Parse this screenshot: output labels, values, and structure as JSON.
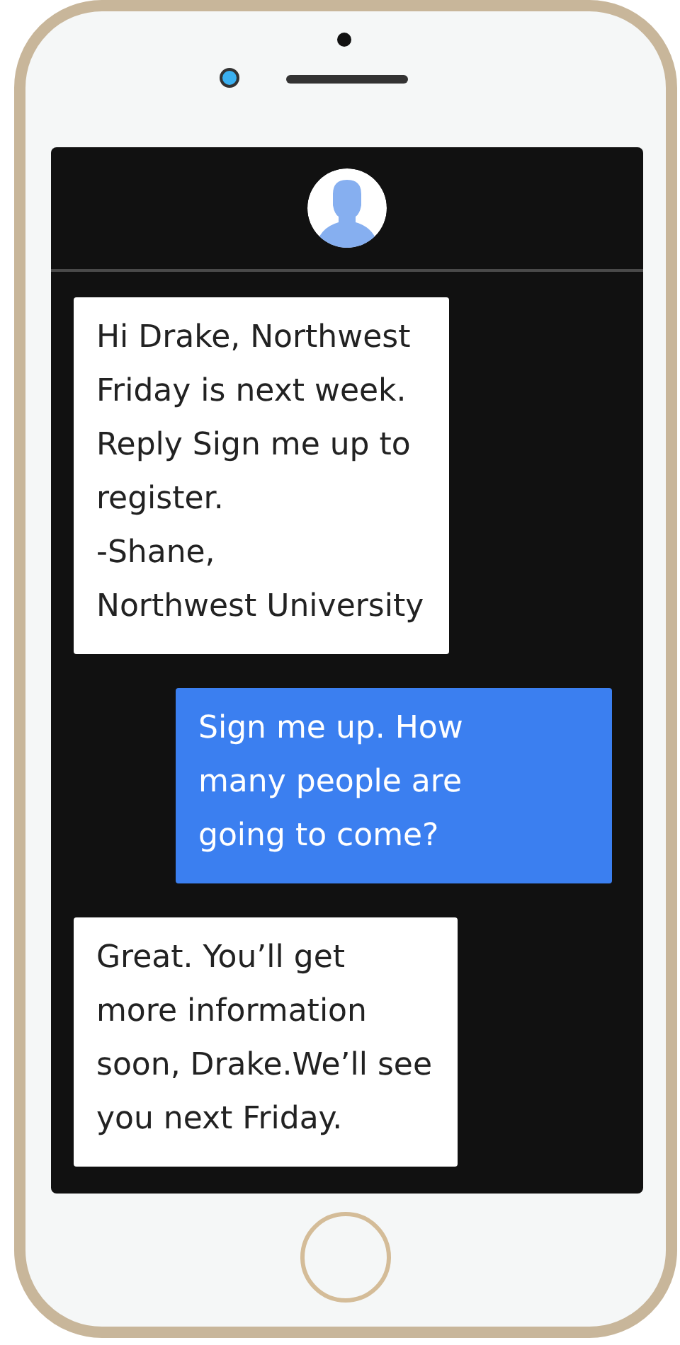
{
  "messages": [
    {
      "kind": "received",
      "text": "Hi Drake, Northwest\nFriday is next week.\nReply Sign me up to\nregister.\n-Shane,\nNorthwest University"
    },
    {
      "kind": "sent",
      "text": "Sign me up. How\nmany people are\ngoing to come?"
    },
    {
      "kind": "received",
      "text": "Great. You’ll get\nmore information\nsoon, Drake.We’ll see\nyou next Friday."
    }
  ]
}
